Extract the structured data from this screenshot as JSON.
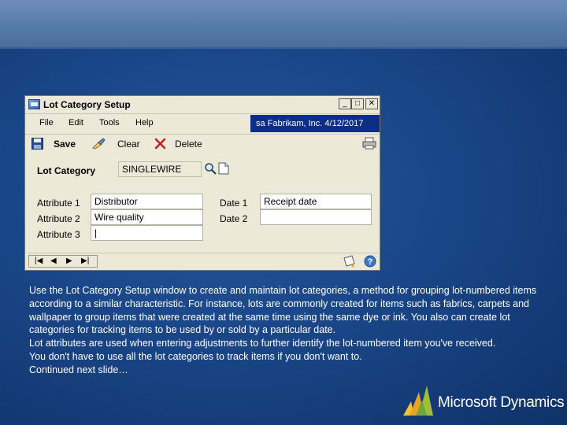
{
  "window": {
    "title": "Lot Category Setup",
    "controls": {
      "minimize": "_",
      "maximize": "□",
      "close": "✕"
    },
    "menu": [
      "File",
      "Edit",
      "Tools",
      "Help"
    ],
    "user_info": "sa  Fabrikam, Inc.  4/12/2017",
    "toolbar": {
      "save": "Save",
      "clear": "Clear",
      "delete": "Delete"
    },
    "lot_category_label": "Lot Category",
    "lot_category_value": "SINGLEWIRE",
    "attributes": [
      {
        "label": "Attribute 1",
        "value": "Distributor"
      },
      {
        "label": "Attribute 2",
        "value": "Wire quality"
      },
      {
        "label": "Attribute 3",
        "value": "|"
      }
    ],
    "dates": [
      {
        "label": "Date 1",
        "value": "Receipt date"
      },
      {
        "label": "Date 2",
        "value": ""
      }
    ],
    "nav": {
      "first": "|◀",
      "prev": "◀",
      "next": "▶",
      "last": "▶|"
    }
  },
  "slide": {
    "paragraphs": [
      "Use the Lot Category Setup window to create and maintain lot categories, a method for grouping lot-numbered items according to a similar characteristic. For instance, lots are commonly created for items such as fabrics, carpets and wallpaper to group items that were created at the same time using the same dye or ink. You also can create lot categories for tracking items to be used by or sold by a particular date.",
      "Lot attributes are used when entering adjustments to further identify the lot-numbered item you've received.",
      "You don't have to use all the lot categories to track items if you don't want to.",
      "Continued next slide…"
    ],
    "logo_text": "Microsoft Dynamics"
  },
  "colors": {
    "info_box": "#0c2f86",
    "window_bg": "#ece9d8",
    "slide_bg": "#1a4688"
  }
}
